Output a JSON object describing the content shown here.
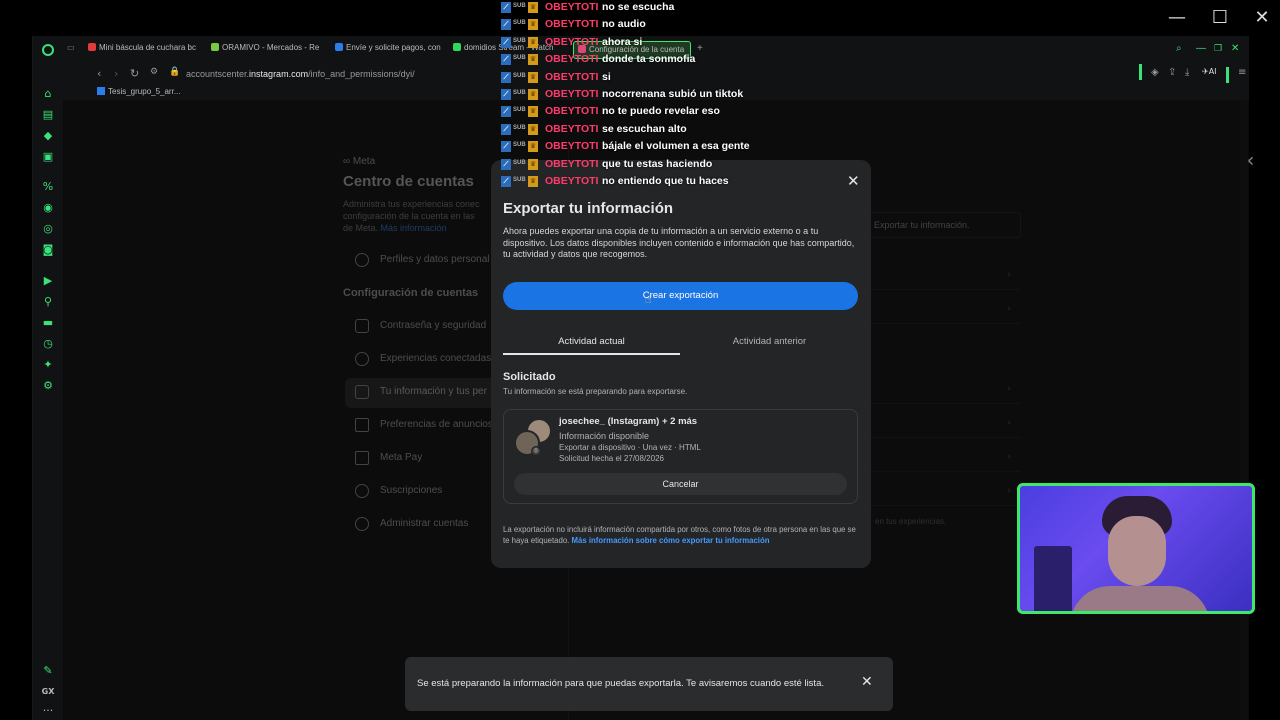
{
  "window": {
    "minimize": "—",
    "maximize": "☐",
    "close": "✕"
  },
  "tabs": [
    {
      "label": "Mini báscula de cuchara bc",
      "color": "#e23b3b"
    },
    {
      "label": "ORAMIVO - Mercados - Re",
      "color": "#7ac943"
    },
    {
      "label": "Envíe y solicite pagos, con",
      "color": "#2b7de9"
    },
    {
      "label": "domidios Stream - Watch",
      "color": "#2fd85a"
    },
    {
      "label": "Configuración de la cuenta",
      "color": "#e0457b"
    }
  ],
  "new_tab": "+",
  "address": {
    "url_prefix": "accountscenter.",
    "url_domain": "instagram.com",
    "url_path": "/info_and_permissions/dyi/"
  },
  "bookmark": {
    "label": "Tesis_grupo_5_arr..."
  },
  "page": {
    "brand": "∞ Meta",
    "title": "Centro de cuentas",
    "description_1": "Administra tus experiencias conec",
    "description_2": "configuración de la cuenta en las",
    "description_3": "de Meta.",
    "more_info_link": "Más información",
    "profiles_item": "Perfiles y datos personal",
    "account_settings_heading": "Configuración de cuentas",
    "side_items": [
      "Contraseña y seguridad",
      "Experiencias conectadas",
      "Tu información y tus per",
      "Preferencias de anuncios",
      "Meta Pay",
      "Suscripciones",
      "Administrar cuentas"
    ],
    "right_panel_hint": "Exportar tu información.",
    "right_panel_footer": "en tus experiencias."
  },
  "modal": {
    "title": "Exportar tu información",
    "body": "Ahora puedes exportar una copia de tu información a un servicio externo o a tu dispositivo. Los datos disponibles incluyen contenido e información que has compartido, tu actividad y datos que recogemos.",
    "create_button": "Crear exportación",
    "tab_current": "Actividad actual",
    "tab_previous": "Actividad anterior",
    "requested_heading": "Solicitado",
    "requested_sub": "Tu información se está preparando para exportarse.",
    "card": {
      "account": "josechee_ (Instagram) + 2 más",
      "status": "Información disponible",
      "detail": "Exportar a dispositivo · Una vez · HTML",
      "date": "Solicitud hecha el 27/08/2026",
      "cancel": "Cancelar"
    },
    "footer": "La exportación no incluirá información compartida por otros, como fotos de otra persona en las que se te haya etiquetado.",
    "footer_link": "Más información sobre cómo exportar tu información"
  },
  "chat": {
    "user": "OBEYTOTI",
    "badge_sub": "SUB",
    "messages": [
      "no se escucha",
      "no audio",
      "ahora si",
      "donde ta sonmofia",
      "si",
      "nocorrenana subió un tiktok",
      "no te puedo revelar eso",
      "se escuchan alto",
      "bájale el volumen a esa gente",
      "que tu estas haciendo",
      "no entiendo que tu haces"
    ]
  },
  "toast": {
    "message": "Se está preparando la información para que puedas exportarla. Te avisaremos cuando esté lista."
  },
  "rail_bottom": {
    "gx": "GX",
    "more": "···"
  }
}
